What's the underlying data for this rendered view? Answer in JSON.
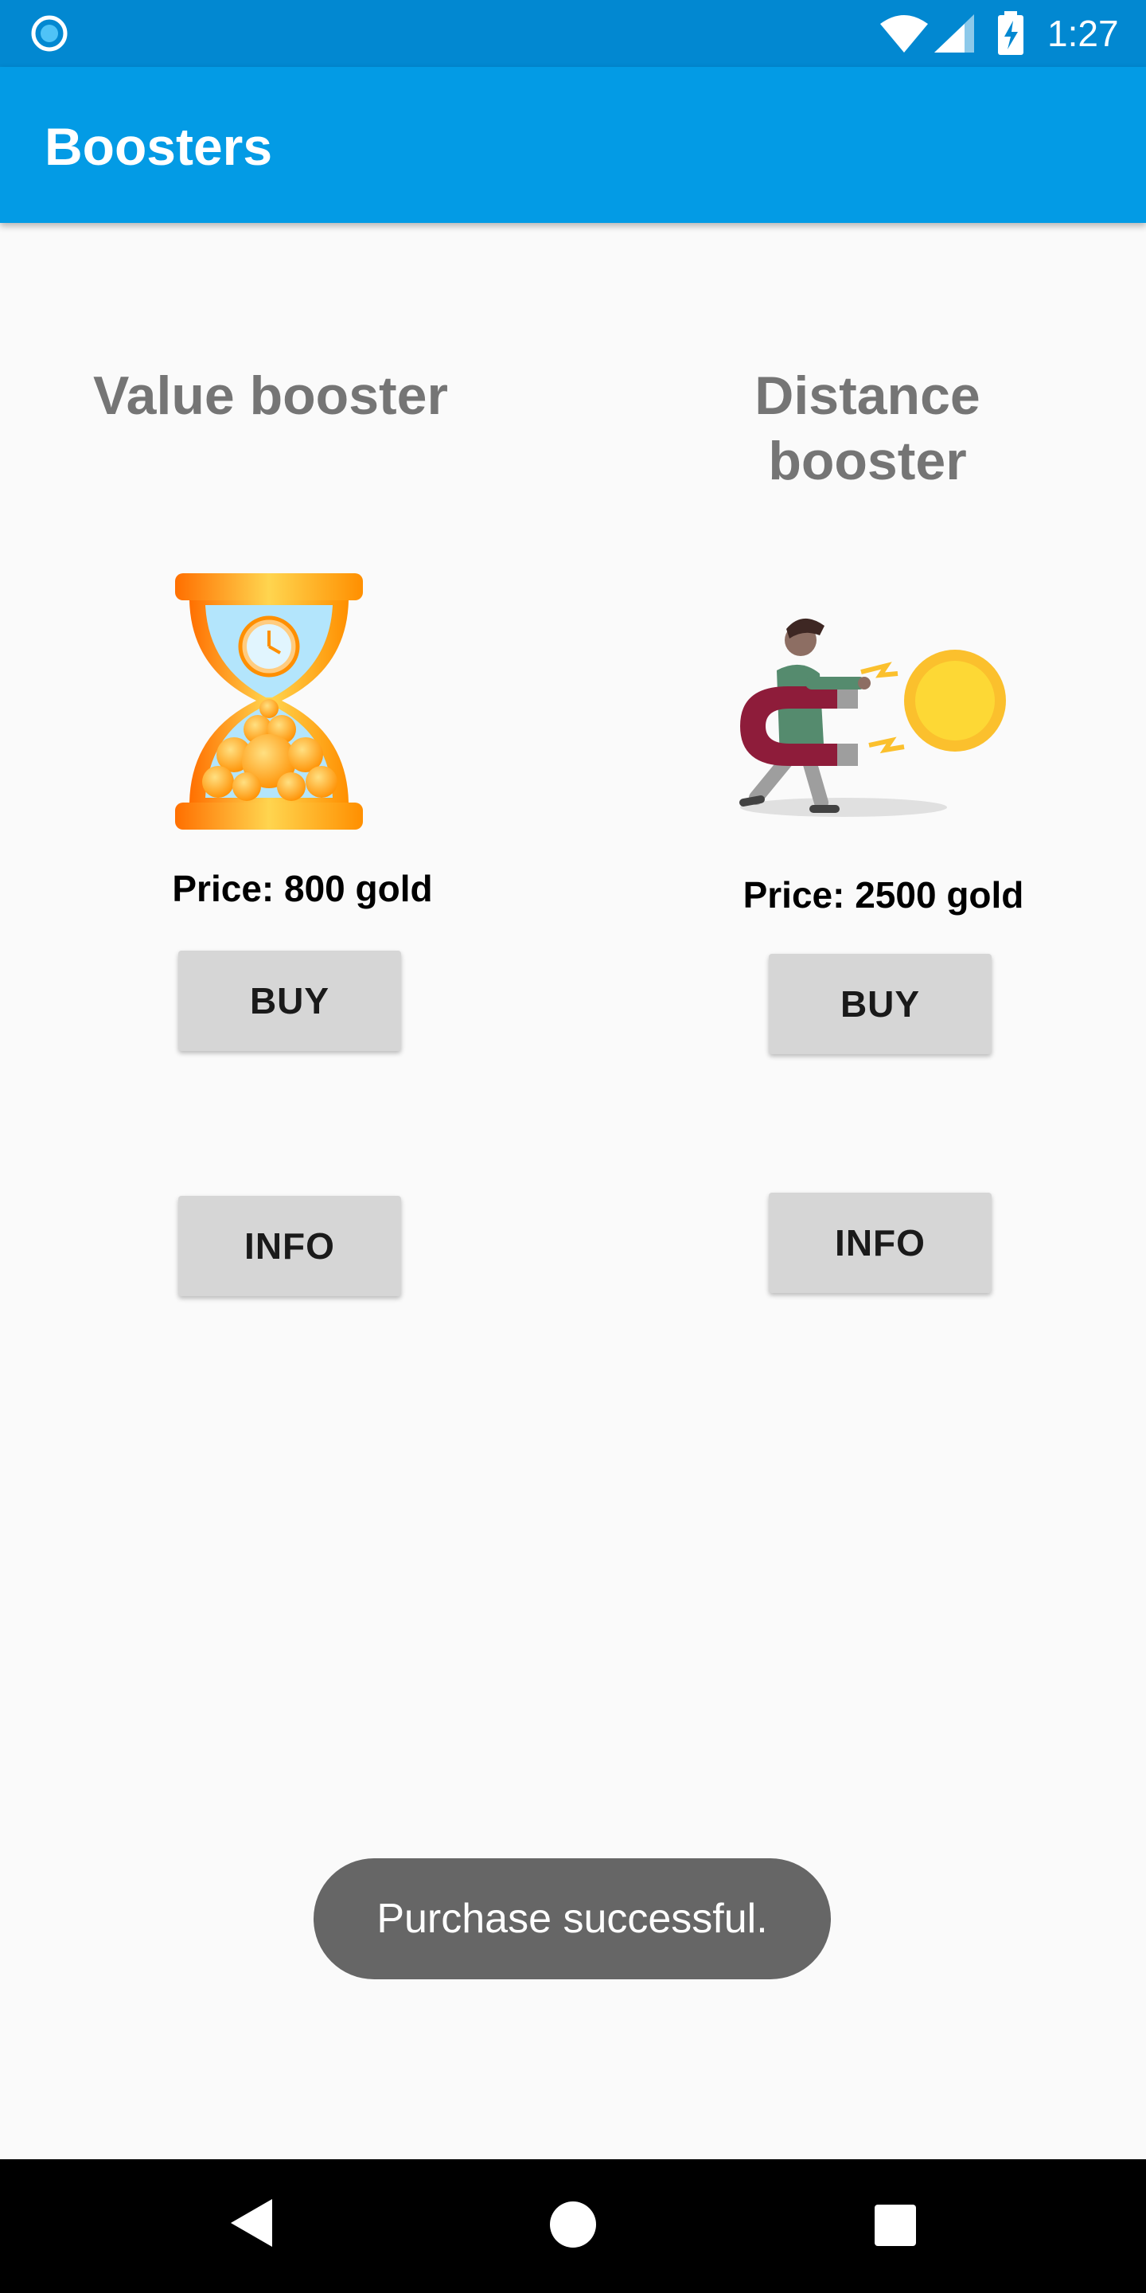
{
  "status_bar": {
    "time": "1:27",
    "icons": [
      "notification-circle-icon",
      "wifi-icon",
      "signal-icon",
      "battery-charging-icon"
    ]
  },
  "app_bar": {
    "title": "Boosters"
  },
  "boosters": [
    {
      "title": "Value booster",
      "image": "hourglass-gold-icon",
      "price": "Price: 800 gold",
      "buy_label": "BUY",
      "info_label": "INFO"
    },
    {
      "title": "Distance booster",
      "image": "magnet-coin-illustration",
      "price": "Price: 2500 gold",
      "buy_label": "BUY",
      "info_label": "INFO"
    }
  ],
  "toast": {
    "message": "Purchase successful."
  },
  "nav_bar": {
    "icons": [
      "back-icon",
      "home-icon",
      "recents-icon"
    ]
  },
  "colors": {
    "status_bar": "#0288d1",
    "app_bar": "#039be5",
    "background": "#fafafa",
    "button": "#d6d6d6",
    "toast": "#666666"
  }
}
